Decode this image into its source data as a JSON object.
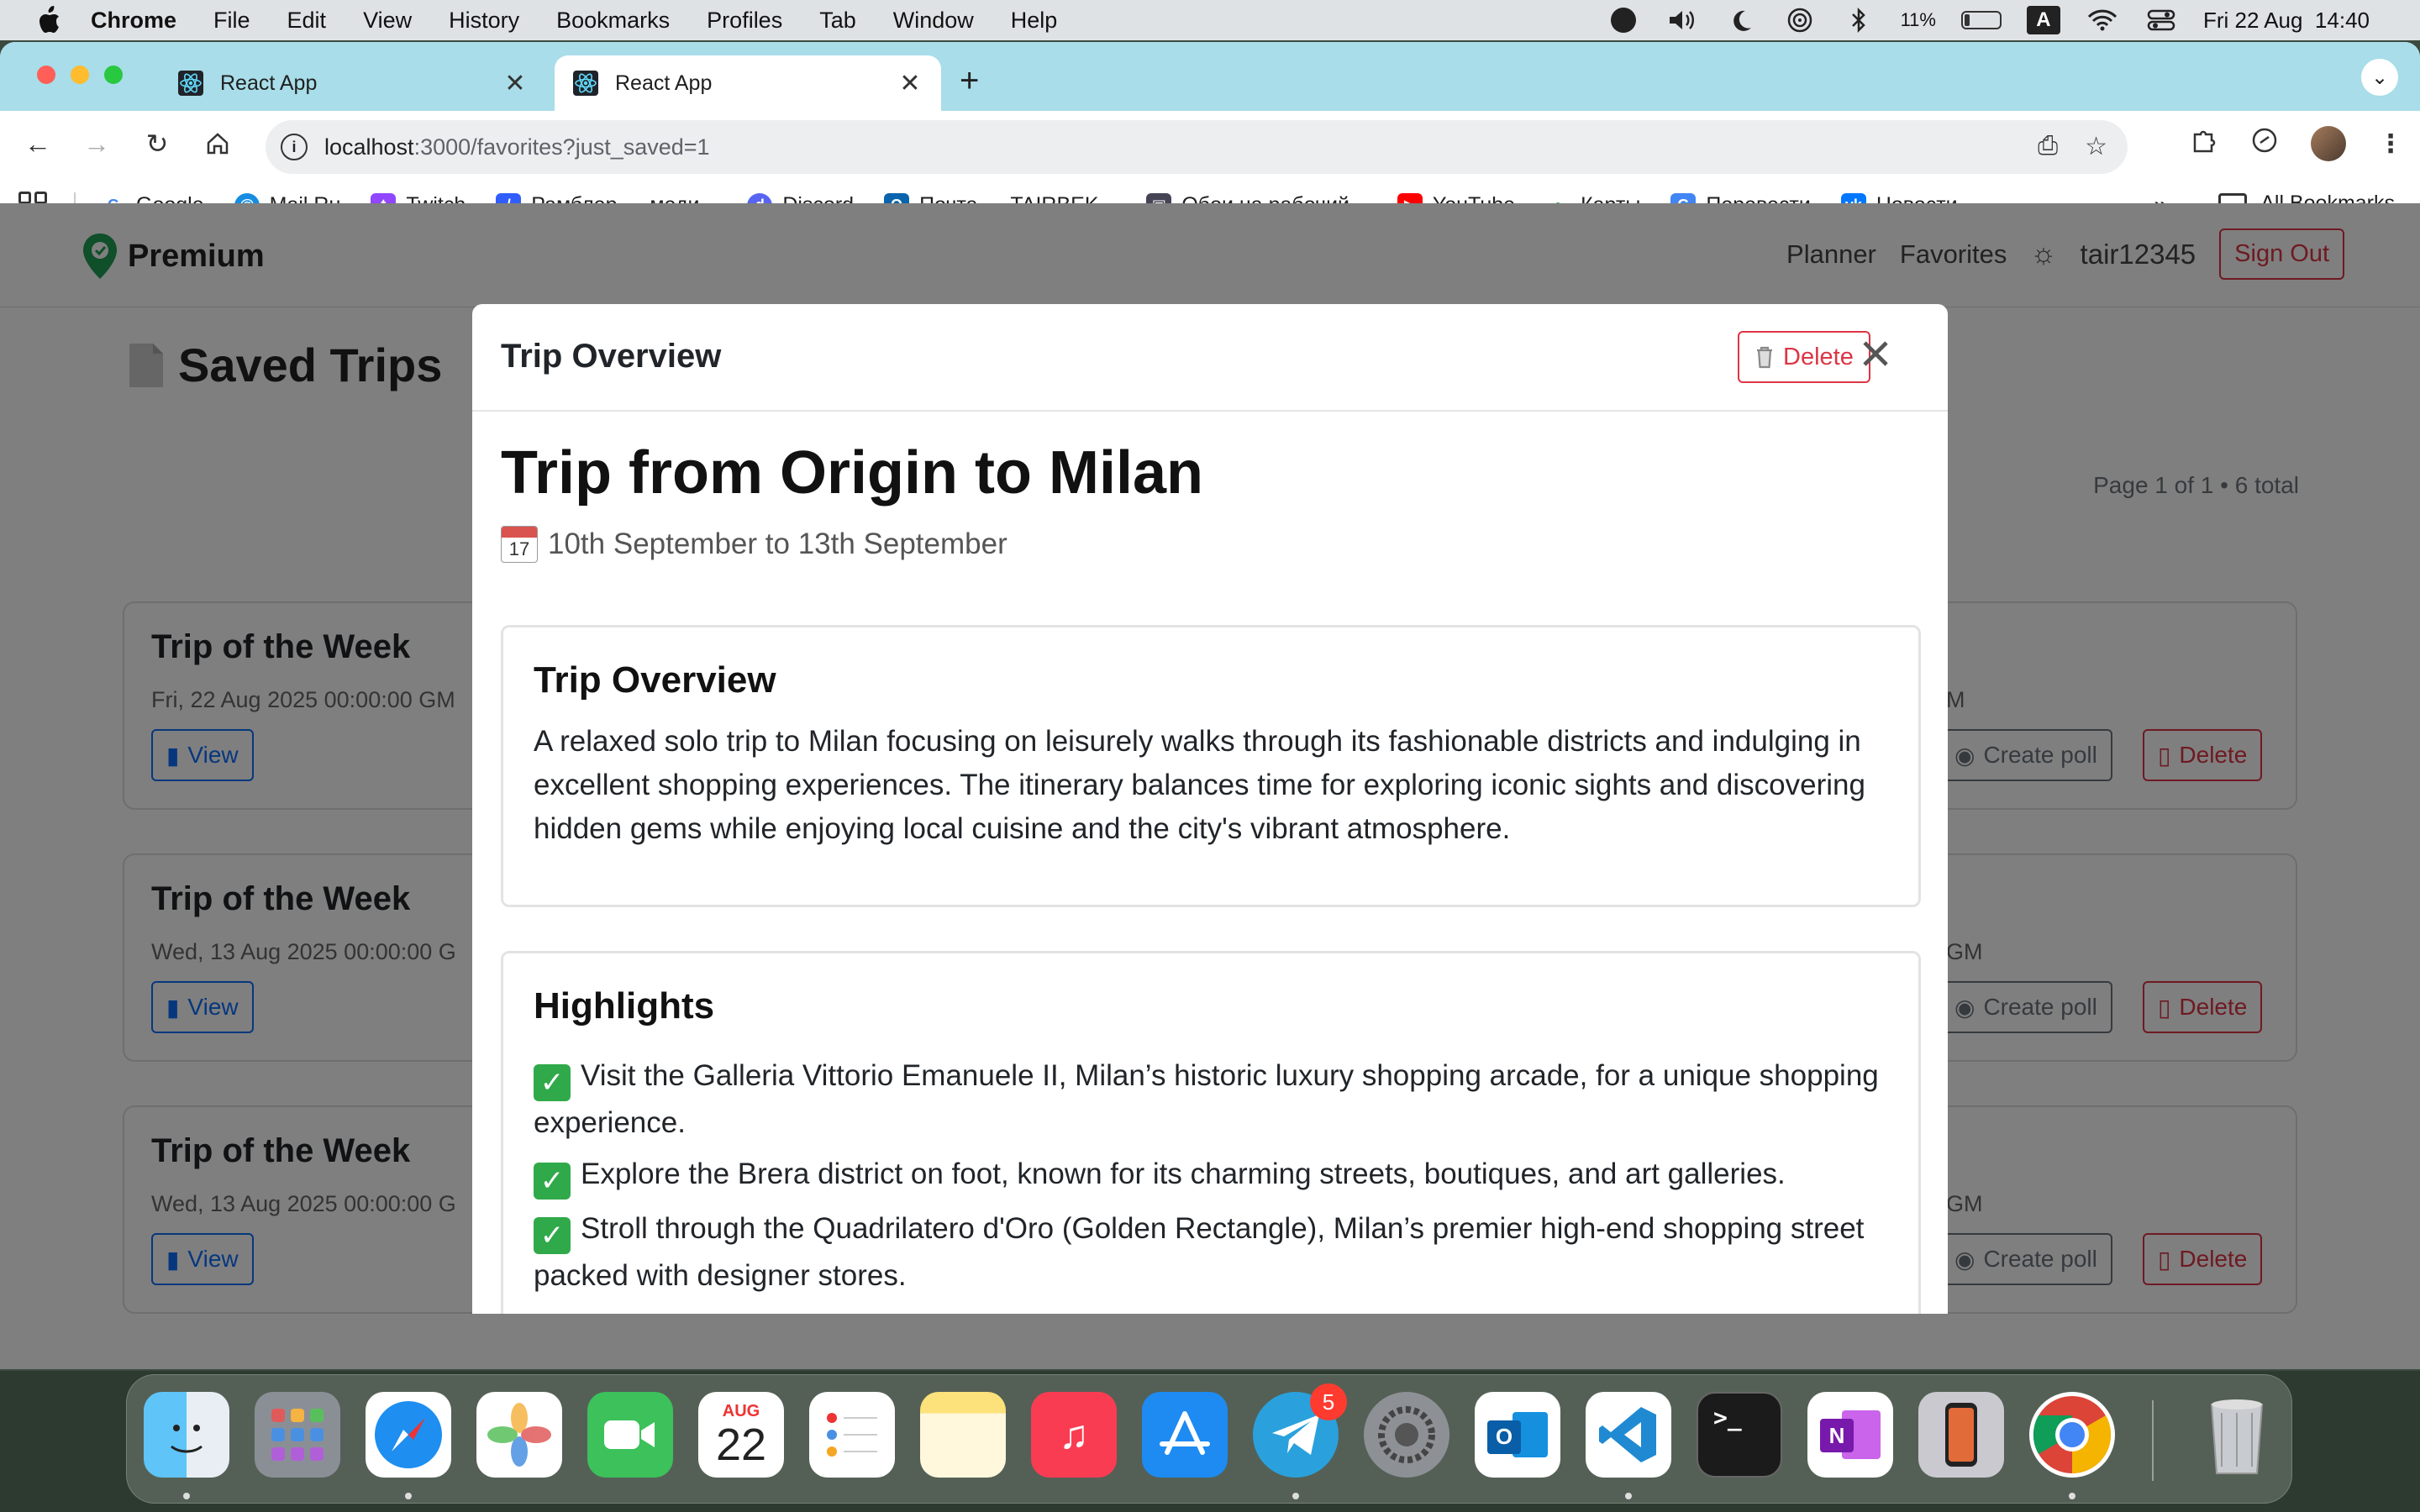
{
  "menubar": {
    "app_name": "Chrome",
    "items": [
      "File",
      "Edit",
      "View",
      "History",
      "Bookmarks",
      "Profiles",
      "Tab",
      "Window",
      "Help"
    ],
    "battery_percent": "11%",
    "input_source": "A",
    "datetime": "Fri 22 Aug  14:40"
  },
  "browser": {
    "tabs": [
      {
        "title": "React App",
        "active": false
      },
      {
        "title": "React App",
        "active": true
      }
    ],
    "url_host": "localhost",
    "url_path": ":3000/favorites?just_saved=1",
    "bookmarks": [
      "Google",
      "Mail.Ru",
      "Twitch",
      "Рамблер — меди...",
      "Discord",
      "Почта — TAIRBEK...",
      "Обои на рабочий...",
      "YouTube",
      "Карты",
      "Перевести",
      "Новости"
    ],
    "all_bookmarks": "All Bookmarks"
  },
  "app": {
    "brand": "Premium",
    "nav": {
      "planner": "Planner",
      "favorites": "Favorites",
      "username": "tair12345",
      "sign_out": "Sign Out"
    },
    "page_title": "Saved Trips",
    "pagination": "Page 1 of 1 • 6 total",
    "cards": [
      {
        "title": "Trip of the Week",
        "date": "Fri, 22 Aug 2025 00:00:00 GM",
        "date_right": "M"
      },
      {
        "title": "Trip of the Week",
        "date": "Wed, 13 Aug 2025 00:00:00 G",
        "date_right": "GM"
      },
      {
        "title": "Trip of the Week",
        "date": "Wed, 13 Aug 2025 00:00:00 G",
        "date_right": "GM"
      }
    ],
    "card_buttons": {
      "view": "View",
      "poll": "Create poll",
      "delete": "Delete"
    }
  },
  "modal": {
    "header_title": "Trip Overview",
    "delete_label": "Delete",
    "close_label": "×",
    "trip_title": "Trip from Origin to Milan",
    "calendar_day": "17",
    "dates": "10th September to 13th September",
    "overview": {
      "heading": "Trip Overview",
      "text": "A relaxed solo trip to Milan focusing on leisurely walks through its fashionable districts and indulging in excellent shopping experiences. The itinerary balances time for exploring iconic sights and discovering hidden gems while enjoying local cuisine and the city's vibrant atmosphere."
    },
    "highlights": {
      "heading": "Highlights",
      "items": [
        "Visit the Galleria Vittorio Emanuele II, Milan’s historic luxury shopping arcade, for a unique shopping experience.",
        "Explore the Brera district on foot, known for its charming streets, boutiques, and art galleries.",
        "Stroll through the Quadrilatero d'Oro (Golden Rectangle), Milan’s premier high-end shopping street packed with designer stores."
      ]
    }
  },
  "dock": {
    "calendar_month": "AUG",
    "calendar_day": "22",
    "telegram_badge": "5"
  }
}
